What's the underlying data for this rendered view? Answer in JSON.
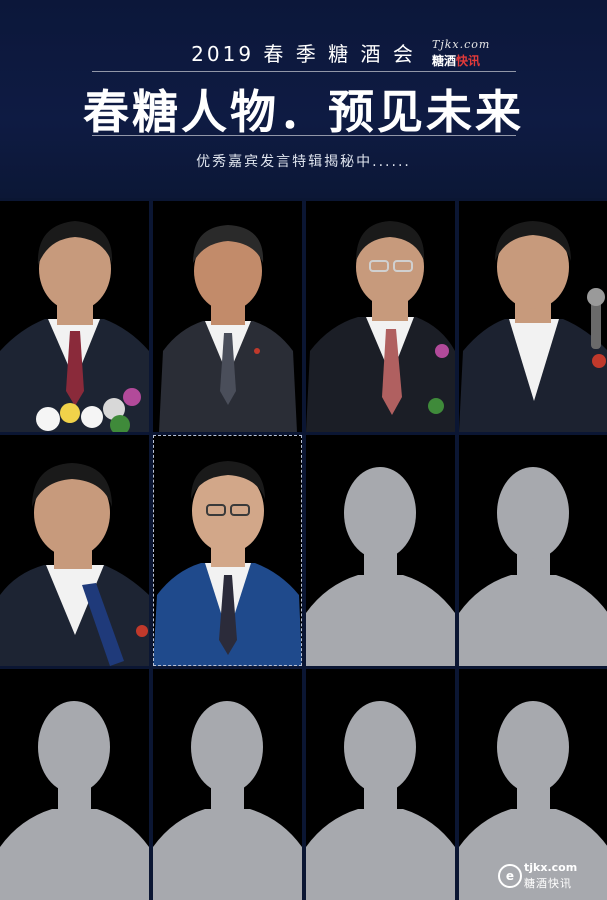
{
  "header": {
    "year_title": "2019 春 季 糖 酒 会",
    "main_title": "春糖人物．预见未来",
    "subtitle": "优秀嘉宾发言特辑揭秘中......",
    "logo_top": "Tjkx.com",
    "logo_bottom_a": "糖酒",
    "logo_bottom_b": "快讯"
  },
  "grid": {
    "rows": 3,
    "cols": 4,
    "revealed_count": 6,
    "placeholder_count": 6,
    "colors": {
      "cell_bg": "#000000",
      "silhouette": "#a7a9ae",
      "suit_dark": "#1d2433",
      "suit_blue": "#1f4a8c",
      "skin": "#c79a7c",
      "hair": "#1a1a1a",
      "shirt": "#f2f2f2"
    }
  },
  "watermark": {
    "site": "tjkx.com",
    "name": "糖酒快讯",
    "badge": "e"
  }
}
